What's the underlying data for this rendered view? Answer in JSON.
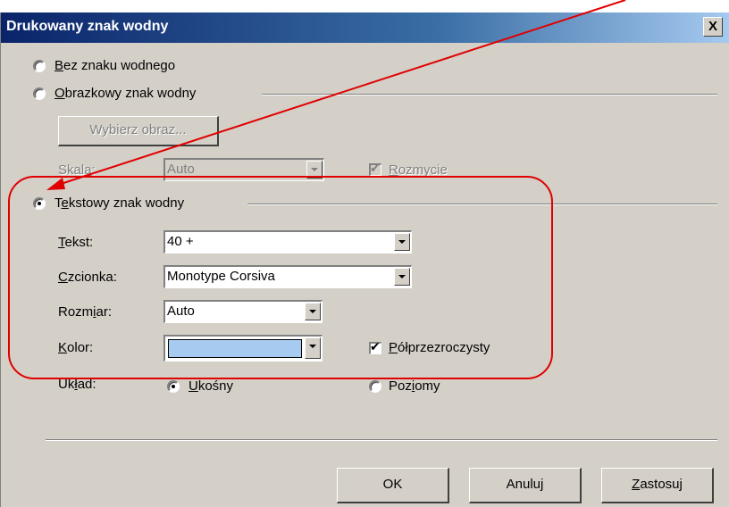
{
  "window": {
    "title": "Drukowany znak wodny",
    "close_label": "X"
  },
  "no_watermark": {
    "prefix": "",
    "ul": "B",
    "rest": "ez znaku wodnego",
    "checked": false
  },
  "picture_watermark": {
    "prefix": "",
    "ul": "O",
    "rest": "brazkowy znak wodny",
    "checked": false,
    "select_button": "Wybierz obraz...",
    "scale_label_prefix": "Skal",
    "scale_label_ul": "a",
    "scale_label_rest": ":",
    "scale_value": "Auto",
    "washout_prefix": "",
    "washout_ul": "R",
    "washout_rest": "ozmycie",
    "washout_checked": true
  },
  "text_watermark": {
    "prefix": "T",
    "ul": "e",
    "rest": "kstowy znak wodny",
    "checked": true,
    "text_label_prefix": "",
    "text_label_ul": "T",
    "text_label_rest": "ekst:",
    "text_value": "40 +",
    "font_label_prefix": "",
    "font_label_ul": "C",
    "font_label_rest": "zcionka:",
    "font_value": "Monotype Corsiva",
    "size_label_prefix": "Rozm",
    "size_label_ul": "i",
    "size_label_rest": "ar:",
    "size_value": "Auto",
    "color_label_prefix": "",
    "color_label_ul": "K",
    "color_label_rest": "olor:",
    "color_value": "#a6caf0",
    "semi_prefix": "",
    "semi_ul": "P",
    "semi_rest": "ółprzezroczysty",
    "semi_checked": true
  },
  "layout_option": {
    "label_prefix": "Uk",
    "label_ul": "ł",
    "label_rest": "ad:",
    "diagonal_prefix": "",
    "diagonal_ul": "U",
    "diagonal_rest": "kośny",
    "diagonal_checked": true,
    "horizontal_prefix": "Poz",
    "horizontal_ul": "i",
    "horizontal_rest": "omy",
    "horizontal_checked": false
  },
  "buttons": {
    "ok": "OK",
    "cancel": "Anuluj",
    "apply_prefix": "",
    "apply_ul": "Z",
    "apply_rest": "astosuj"
  },
  "annotation_color": "#e00000"
}
